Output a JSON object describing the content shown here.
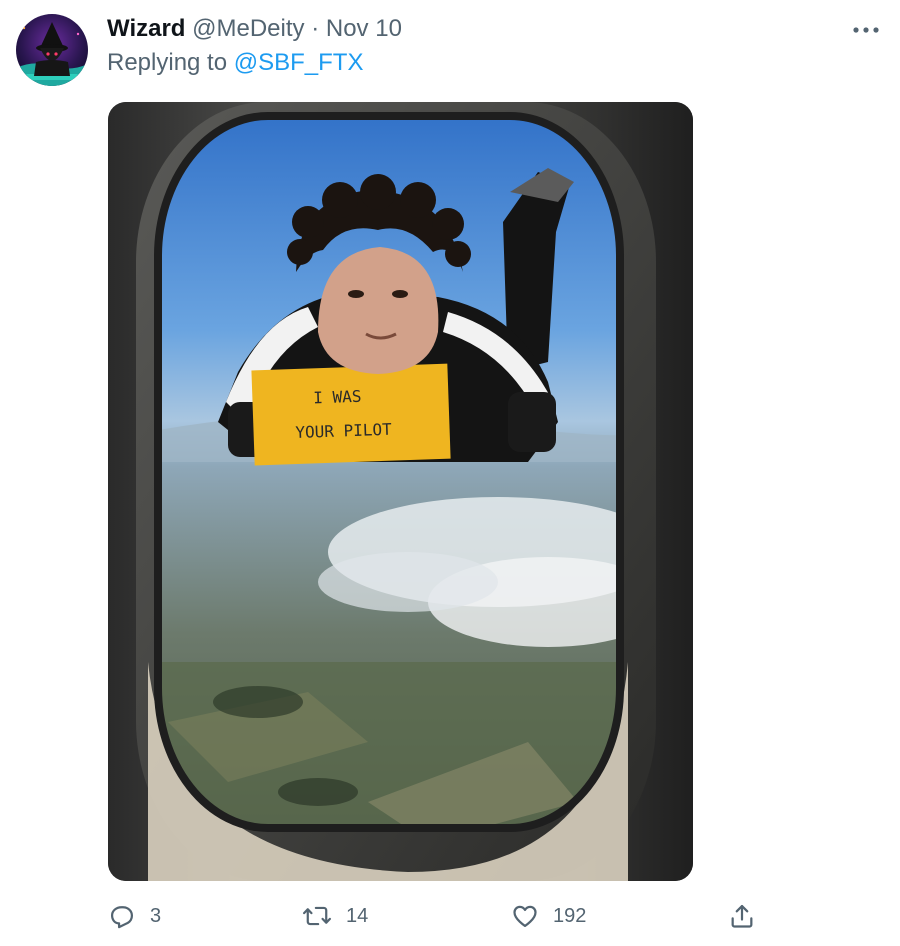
{
  "tweet": {
    "author": {
      "display_name": "Wizard",
      "handle": "@MeDeity",
      "separator": "·",
      "date": "Nov 10",
      "avatar_icon": "wizard-avatar-icon"
    },
    "reply_prefix": "Replying to",
    "reply_to": "@SBF_FTX",
    "more_icon": "more-options-icon",
    "media": {
      "sign_line1": "I WAS",
      "sign_line2": "YOUR PILOT"
    },
    "actions": {
      "replies": "3",
      "retweets": "14",
      "likes": "192"
    }
  },
  "colors": {
    "accent": "#1d9bf0",
    "secondary_text": "#536471",
    "primary_text": "#0f1419"
  }
}
